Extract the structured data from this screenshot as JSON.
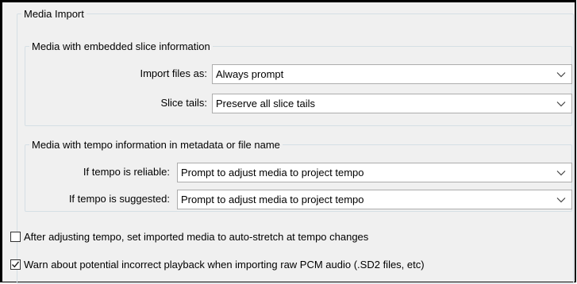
{
  "media_import": {
    "title": "Media Import",
    "slice_group": {
      "title": "Media with embedded slice information",
      "import_files_as": {
        "label": "Import files as:",
        "value": "Always prompt"
      },
      "slice_tails": {
        "label": "Slice tails:",
        "value": "Preserve all slice tails"
      }
    },
    "tempo_group": {
      "title": "Media with tempo information in metadata or file name",
      "if_reliable": {
        "label": "If tempo is reliable:",
        "value": "Prompt to adjust media to project tempo"
      },
      "if_suggested": {
        "label": "If tempo is suggested:",
        "value": "Prompt to adjust media to project tempo"
      }
    },
    "options": [
      {
        "label": "After adjusting tempo, set imported media to auto-stretch at tempo changes",
        "checked": false
      },
      {
        "label": "Warn about potential incorrect playback when importing raw PCM audio (.SD2 files, etc)",
        "checked": true
      }
    ],
    "icons": {
      "dropdown": "chevron-down-icon",
      "check": "checkmark-icon"
    }
  }
}
